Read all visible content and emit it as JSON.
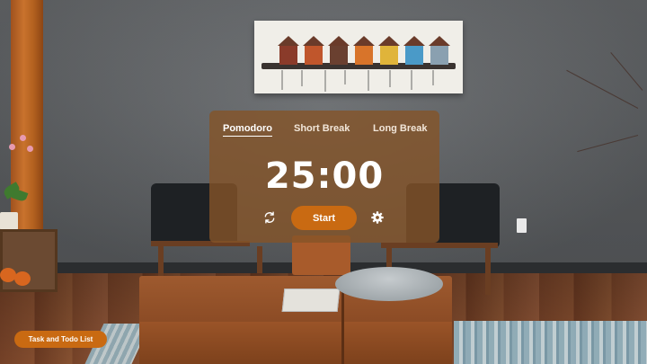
{
  "tabs": [
    {
      "label": "Pomodoro",
      "active": true
    },
    {
      "label": "Short Break",
      "active": false
    },
    {
      "label": "Long Break",
      "active": false
    }
  ],
  "timer": {
    "display": "25:00"
  },
  "controls": {
    "start_label": "Start",
    "reset_icon": "reset-icon",
    "settings_icon": "gear-icon"
  },
  "task_button": {
    "label": "Task and Todo List"
  },
  "colors": {
    "accent": "#c96a12",
    "card": "#845428",
    "text": "#ffffff"
  }
}
